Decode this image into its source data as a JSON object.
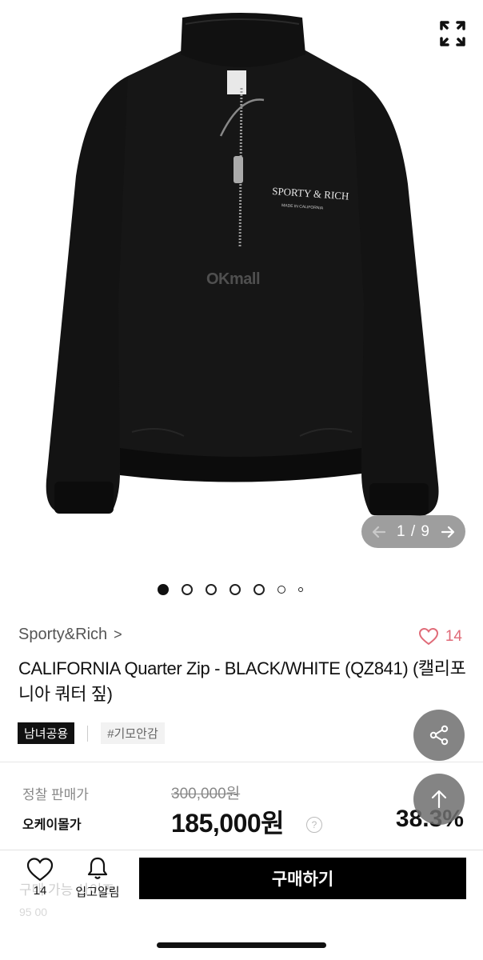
{
  "hero": {
    "watermark": "OKmall",
    "print_line1": "SPORTY & RICH",
    "print_line2": "MADE IN CALIFORNIA",
    "expand_icon": "expand-icon",
    "pager": {
      "text": "1 / 9",
      "prev_icon": "arrow-left-icon",
      "next_icon": "arrow-right-icon"
    }
  },
  "carousel_dots": {
    "count": 7,
    "active_index": 0
  },
  "product": {
    "brand": "Sporty&Rich",
    "brand_chevron": ">",
    "like_count": "14",
    "title": "CALIFORNIA Quarter Zip - BLACK/WHITE (QZ841) (캘리포니아 쿼터 짚)",
    "tag_primary": "남녀공용",
    "tag_secondary": "#기모안감"
  },
  "pricing": {
    "list_label": "정찰 판매가",
    "list_price": "300,000원",
    "sale_label": "오케이몰가",
    "sale_price": "185,000원",
    "help": "?",
    "discount": "38.3%"
  },
  "bottom_bar": {
    "ghost_text": "구매 가능 사이즈",
    "ghost_text2": "95  00",
    "wish_count": "14",
    "alarm_label": "입고알림",
    "buy_label": "구매하기"
  },
  "colors": {
    "accent_pink": "#e06b78",
    "garment_black": "#111111",
    "buy_button": "#000000"
  }
}
